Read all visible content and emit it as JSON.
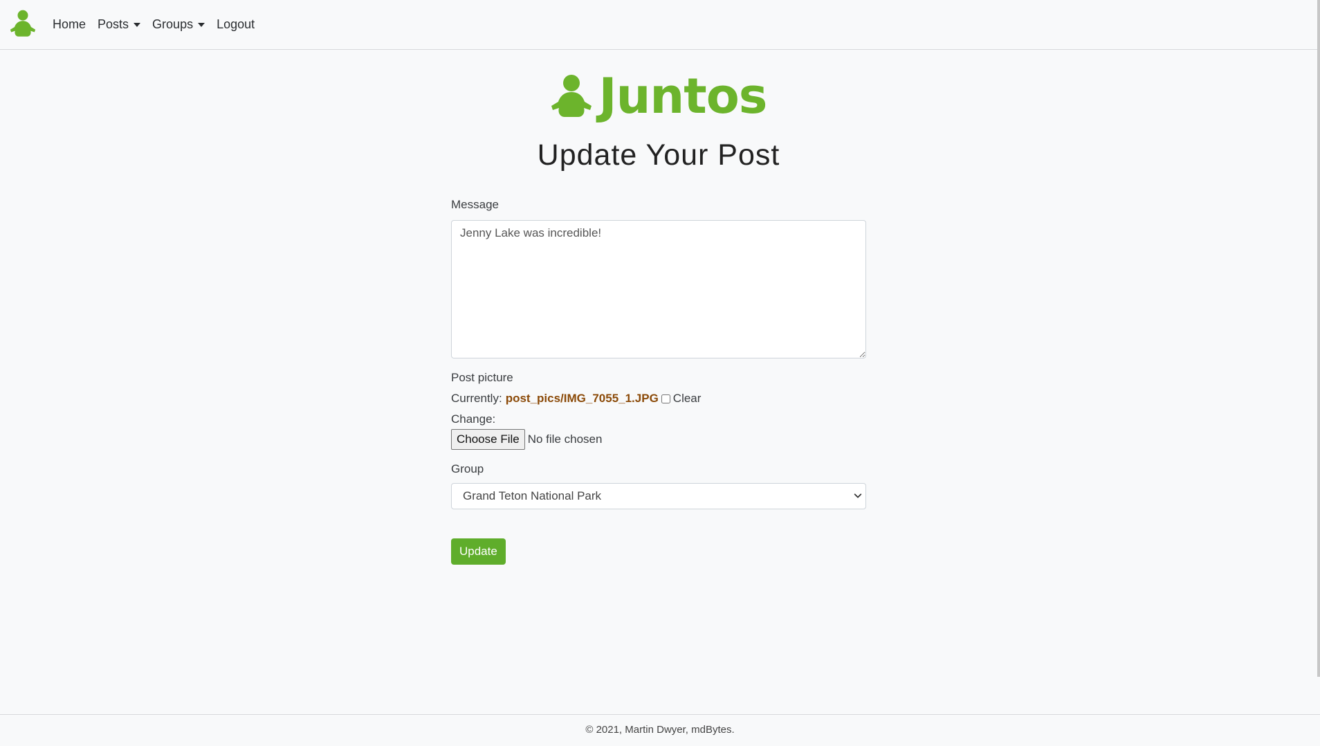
{
  "nav": {
    "home": "Home",
    "posts": "Posts",
    "groups": "Groups",
    "logout": "Logout"
  },
  "brand": {
    "name": "Juntos",
    "color": "#6cb42c"
  },
  "page": {
    "title": "Update Your Post"
  },
  "form": {
    "message_label": "Message",
    "message_value": "Jenny Lake was incredible!",
    "picture_label": "Post picture",
    "currently_label": "Currently:",
    "current_file": "post_pics/IMG_7055_1.JPG",
    "clear_label": "Clear",
    "change_label": "Change:",
    "choose_file_label": "Choose File",
    "no_file_text": "No file chosen",
    "group_label": "Group",
    "group_selected": "Grand Teton National Park",
    "submit_label": "Update"
  },
  "footer": {
    "text": "© 2021, Martin Dwyer, mdBytes."
  },
  "colors": {
    "accent": "#5fad2b",
    "link": "#8b4a08"
  },
  "icons": {
    "logo": "person-icon",
    "dropdown": "caret-down-icon",
    "select": "chevron-down-icon"
  }
}
